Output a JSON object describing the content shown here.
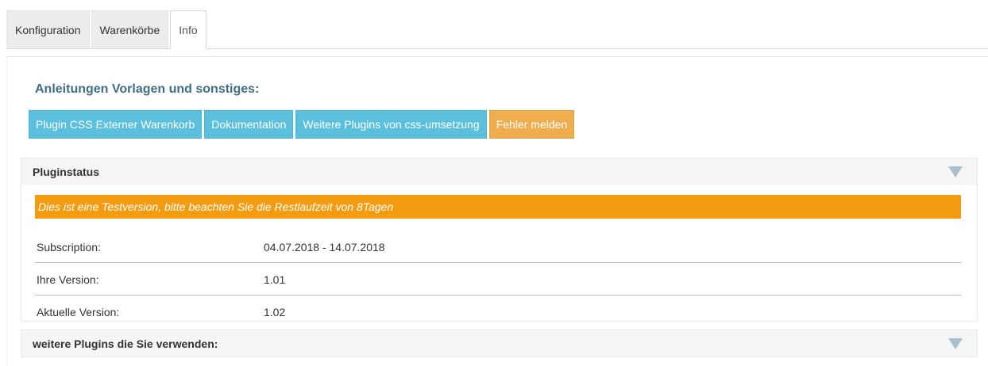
{
  "tabs": [
    {
      "label": "Konfiguration"
    },
    {
      "label": "Warenkörbe"
    },
    {
      "label": "Info"
    }
  ],
  "section": {
    "title": "Anleitungen Vorlagen und sonstiges:"
  },
  "buttons": {
    "plugin_css": "Plugin CSS Externer Warenkorb",
    "dokumentation": "Dokumentation",
    "weitere_plugins": "Weitere Plugins von css-umsetzung",
    "fehler_melden": "Fehler melden"
  },
  "pluginstatus": {
    "title": "Pluginstatus",
    "warning": "Dies ist eine Testversion, bitte beachten Sie die Restlaufzeit von 8Tagen",
    "rows": [
      {
        "label": "Subscription:",
        "value": "04.07.2018 - 14.07.2018"
      },
      {
        "label": "Ihre Version:",
        "value": "1.01"
      },
      {
        "label": "Aktuelle Version:",
        "value": "1.02"
      }
    ]
  },
  "weitere": {
    "title": "weitere Plugins die Sie verwenden:"
  },
  "colors": {
    "accent_blue": "#5bc0de",
    "accent_orange": "#f0ad4e",
    "warning": "#f39c12",
    "title": "#3f6f86"
  },
  "icons": {
    "expand": "triangle-down-icon"
  }
}
